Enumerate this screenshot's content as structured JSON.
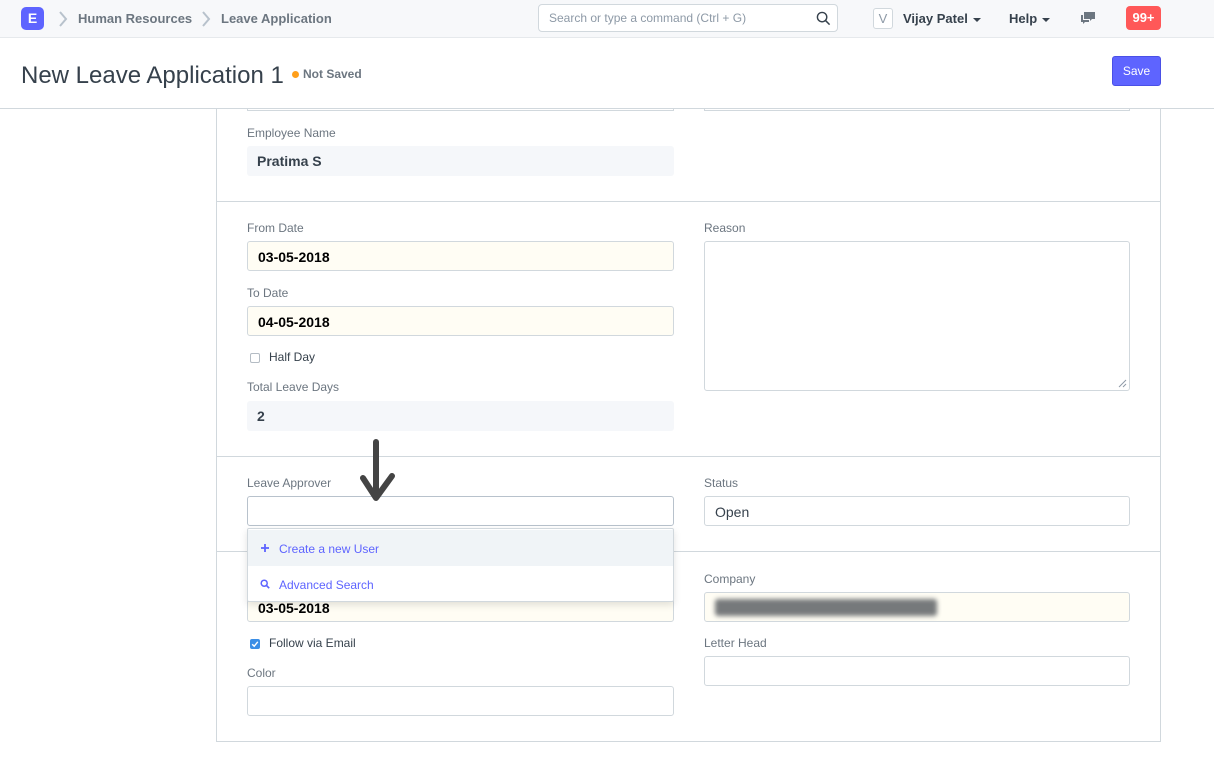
{
  "app": {
    "logo_letter": "E"
  },
  "breadcrumbs": [
    "Human Resources",
    "Leave Application"
  ],
  "search": {
    "placeholder": "Search or type a command (Ctrl + G)"
  },
  "user": {
    "avatar_letter": "V",
    "name": "Vijay Patel"
  },
  "help_label": "Help",
  "notifications": {
    "count": "99+"
  },
  "page": {
    "title": "New Leave Application 1",
    "status": "Not Saved",
    "save_label": "Save"
  },
  "form": {
    "employee_name": {
      "label": "Employee Name",
      "value": "Pratima S"
    },
    "from_date": {
      "label": "From Date",
      "value": "03-05-2018"
    },
    "to_date": {
      "label": "To Date",
      "value": "04-05-2018"
    },
    "half_day": {
      "label": "Half Day",
      "checked": false
    },
    "total_leave_days": {
      "label": "Total Leave Days",
      "value": "2"
    },
    "reason": {
      "label": "Reason",
      "value": ""
    },
    "leave_approver": {
      "label": "Leave Approver",
      "value": ""
    },
    "status": {
      "label": "Status",
      "value": "Open"
    },
    "posting_date": {
      "value": "03-05-2018"
    },
    "follow_via_email": {
      "label": "Follow via Email",
      "checked": true
    },
    "color": {
      "label": "Color",
      "value": ""
    },
    "company": {
      "label": "Company"
    },
    "letter_head": {
      "label": "Letter Head",
      "value": ""
    }
  },
  "dropdown": {
    "items": [
      {
        "icon": "plus-icon",
        "label": "Create a new User"
      },
      {
        "icon": "search-icon",
        "label": "Advanced Search"
      }
    ]
  },
  "colors": {
    "primary": "#5e64ff",
    "indicator_orange": "#ff9f1a",
    "notification_red": "#ff5858",
    "checkbox_blue": "#3b8ee6"
  }
}
